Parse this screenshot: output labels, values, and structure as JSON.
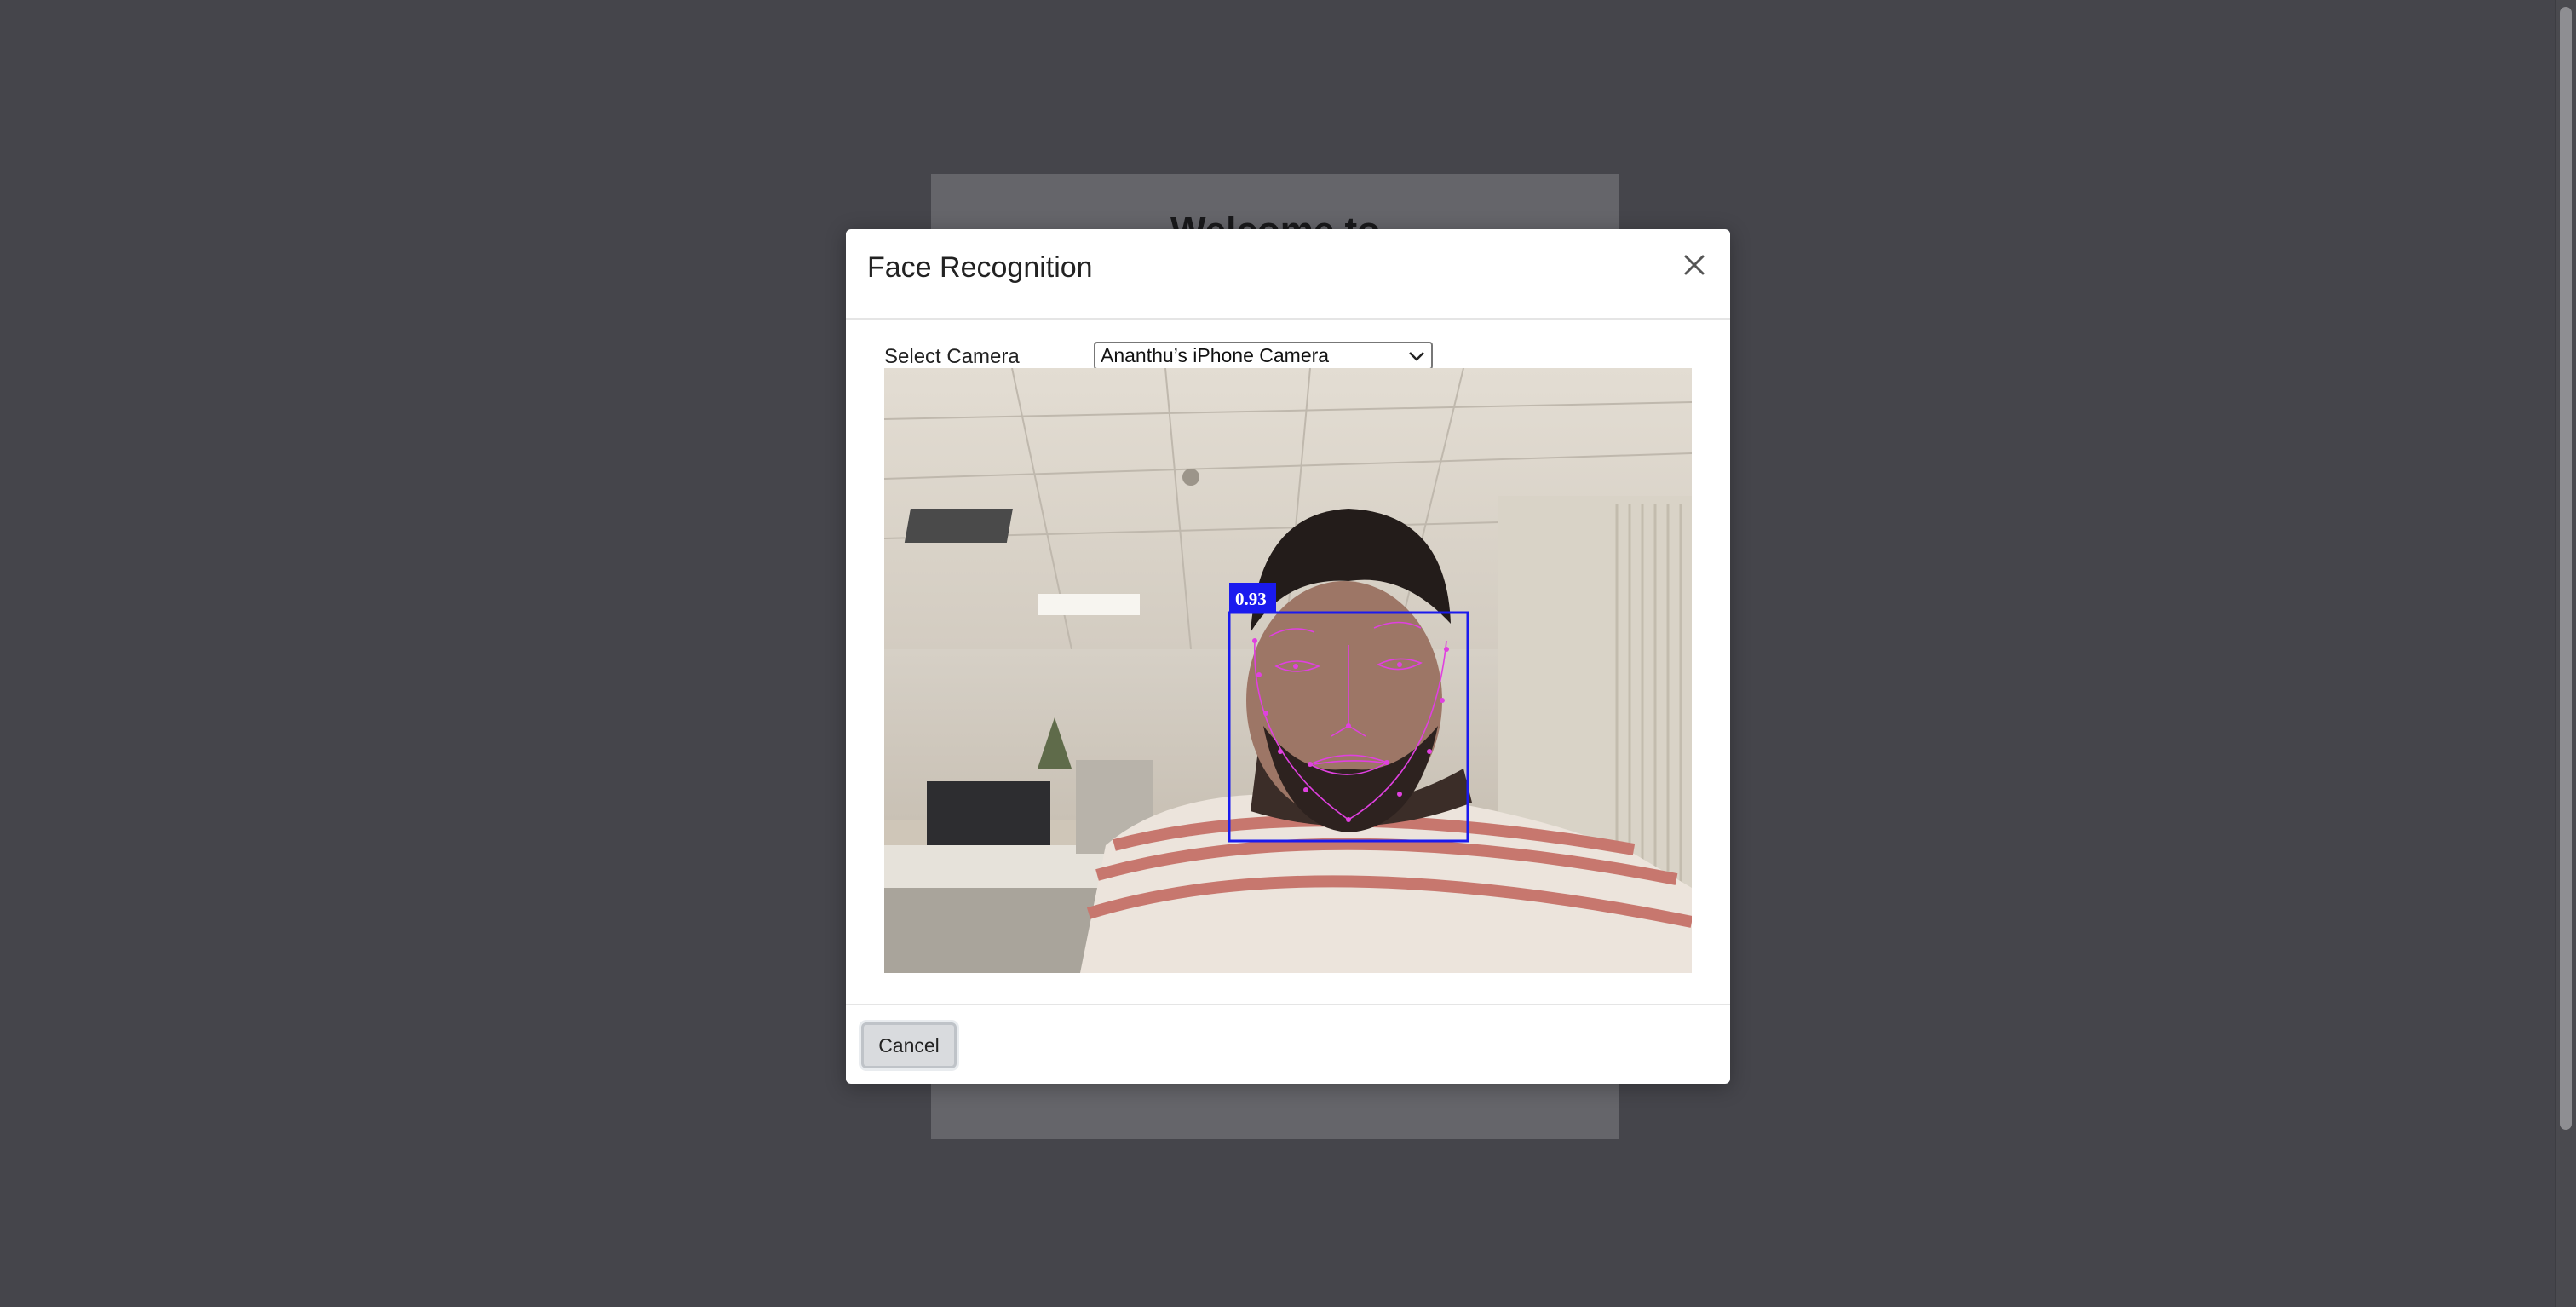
{
  "background_page": {
    "title": "Welcome to"
  },
  "modal": {
    "title": "Face Recognition",
    "close_icon": "close-icon",
    "camera_label": "Select Camera",
    "camera_selected": "Ananthu’s iPhone Camera",
    "detection": {
      "confidence_label": "0.93"
    },
    "cancel_label": "Cancel"
  },
  "colors": {
    "detection_box": "#1a1aee",
    "landmarks": "#e040e0",
    "backdrop": "#55555b"
  }
}
